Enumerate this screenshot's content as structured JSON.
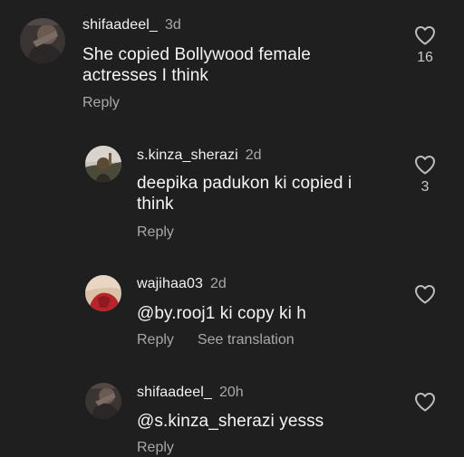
{
  "comments": [
    {
      "username": "shifaadeel_",
      "time": "3d",
      "text_lines": [
        "She copied Bollywood female",
        "actresses I think"
      ],
      "reply_label": "Reply",
      "likes": "16"
    },
    {
      "username": "s.kinza_sherazi",
      "time": "2d",
      "text_lines": [
        "deepika padukon ki copied i",
        "think"
      ],
      "reply_label": "Reply",
      "likes": "3"
    },
    {
      "username": "wajihaa03",
      "time": "2d",
      "text_lines": [
        "@by.rooj1 ki copy ki h"
      ],
      "reply_label": "Reply",
      "translation_label": "See translation"
    },
    {
      "username": "shifaadeel_",
      "time": "20h",
      "text_lines": [
        "@s.kinza_sherazi yesss"
      ],
      "reply_label": "Reply"
    }
  ],
  "icons": {
    "like": "heart-outline-icon"
  },
  "colors": {
    "background": "#1f1f1f",
    "primary_text": "#f2f2f2",
    "secondary_text": "#a8a8a8"
  }
}
